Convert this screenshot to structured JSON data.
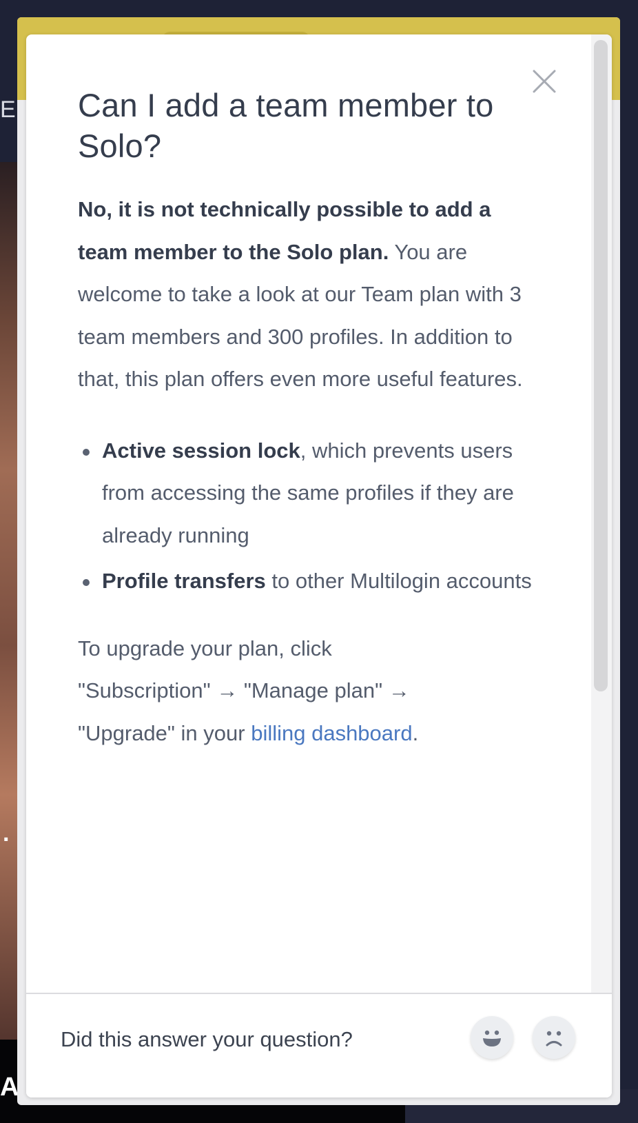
{
  "background": {
    "left_text_top": "EN",
    "left_text_mid": ".",
    "left_text_bottom": "A"
  },
  "article": {
    "title": "Can I add a team member to Solo?",
    "intro_bold": "No, it is not technically possible to add a team member to the Solo plan.",
    "intro_rest": " You are welcome to take a look at our Team plan with 3 team members and 300 profiles. In addition to that, this plan offers even more useful features.",
    "features": [
      {
        "name": "Active session lock",
        "description": ", which prevents users from accessing the same profiles if they are already running"
      },
      {
        "name": "Profile transfers",
        "description": " to other Multilogin accounts"
      }
    ],
    "upgrade_text": "To upgrade your plan, click \"Subscription\" → \"Manage plan\" → \"Upgrade\" in your ",
    "upgrade_link": "billing dashboard",
    "upgrade_end": "."
  },
  "icons": {
    "close": "close-icon",
    "happy": "happy-face-icon",
    "sad": "sad-face-icon"
  },
  "feedback": {
    "question": "Did this answer your question?"
  },
  "colors": {
    "header_yellow": "#d5c04d",
    "link_blue": "#4a78c0",
    "title": "#353d4d",
    "body": "#545c6c"
  }
}
